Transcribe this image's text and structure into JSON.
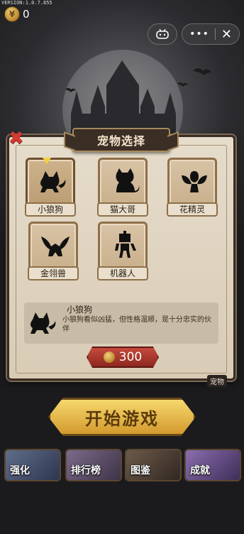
{
  "version": "VERSION:1.0.7.855",
  "currency": {
    "count": "0"
  },
  "topbar": {
    "menu_dots": "•••",
    "close_glyph": "✕"
  },
  "panel": {
    "title": "宠物选择",
    "close_glyph": "✖",
    "pets": [
      {
        "name": "小狼狗"
      },
      {
        "name": "猫大哥"
      },
      {
        "name": "花精灵"
      },
      {
        "name": "金翎兽"
      },
      {
        "name": "机器人"
      }
    ],
    "selected": {
      "name": "小狼狗",
      "description": "小狼狗看似凶猛，但性格温顺，是十分忠实的伙伴"
    },
    "price": "300"
  },
  "pet_tab": "宠物",
  "start_button": "开始游戏",
  "nav": [
    {
      "label": "强化"
    },
    {
      "label": "排行榜"
    },
    {
      "label": "图鉴"
    },
    {
      "label": "成就"
    }
  ],
  "colors": {
    "accent_gold": "#e9b94a",
    "danger_red": "#d23a33",
    "parchment": "#e6dccb",
    "frame_brown": "#3b2e25"
  }
}
